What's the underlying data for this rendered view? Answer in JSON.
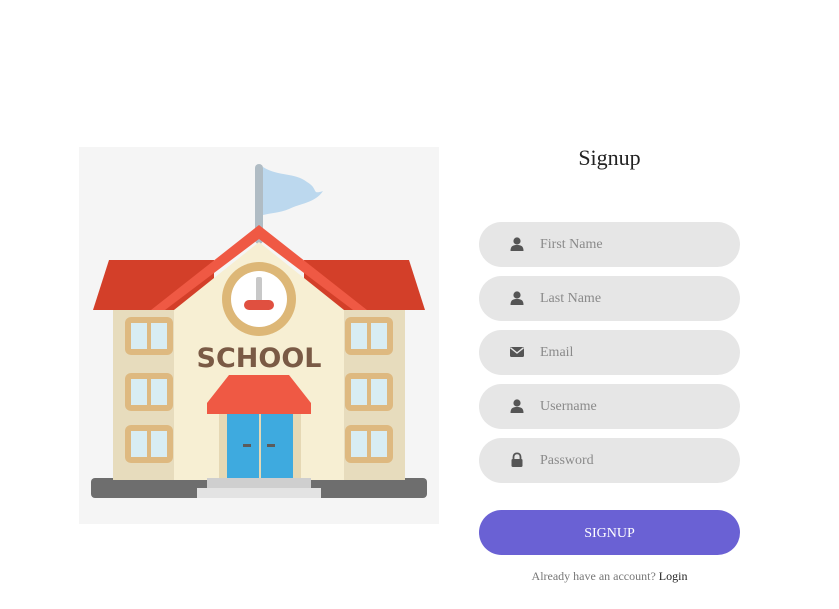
{
  "illustration": {
    "sign_text": "SCHOOL"
  },
  "signup_form": {
    "title": "Signup",
    "fields": [
      {
        "placeholder": "First Name",
        "value": "",
        "icon": "user-icon"
      },
      {
        "placeholder": "Last Name",
        "value": "",
        "icon": "user-icon"
      },
      {
        "placeholder": "Email",
        "value": "",
        "icon": "envelope-icon"
      },
      {
        "placeholder": "Username",
        "value": "",
        "icon": "user-icon"
      },
      {
        "placeholder": "Password",
        "value": "",
        "icon": "lock-icon"
      }
    ],
    "submit_label": "SIGNUP",
    "login_prompt": "Already have an account?",
    "login_link": "Login"
  },
  "colors": {
    "button": "#6a61d4",
    "field_background": "#e6e6e6",
    "icon": "#555555"
  }
}
